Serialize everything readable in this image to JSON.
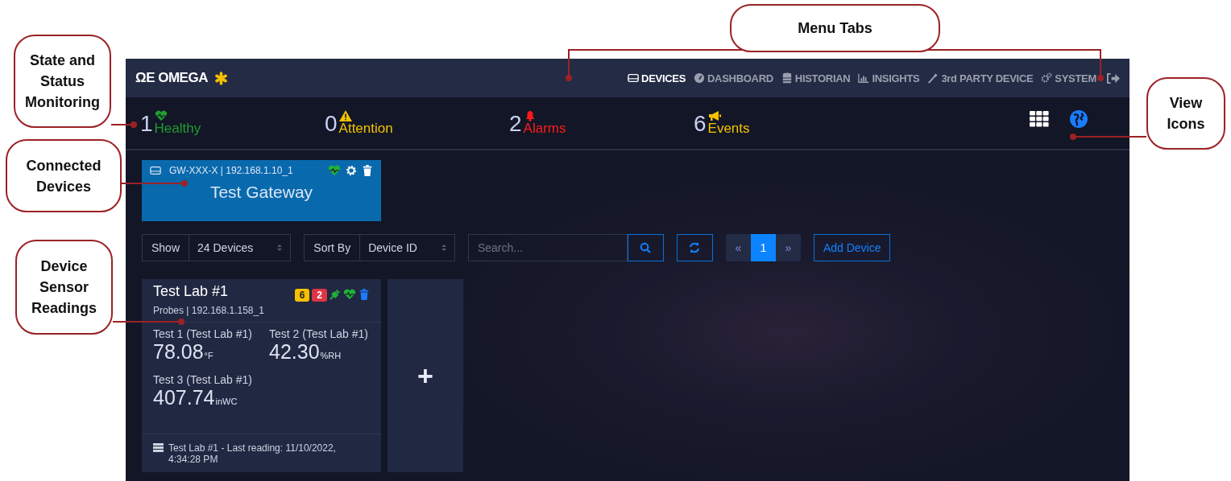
{
  "callouts": [
    {
      "kind": "tabs",
      "text": "Menu Tabs"
    },
    {
      "kind": "status",
      "text": "State and Status Monitoring"
    },
    {
      "kind": "devices",
      "text": "Connected Devices"
    },
    {
      "kind": "readings",
      "text": "Device Sensor Readings"
    },
    {
      "kind": "view",
      "text": "View Icons"
    }
  ],
  "header": {
    "logo": "OMEGA",
    "logo_mark": "ΩE",
    "tabs": [
      {
        "kind": "devices",
        "label": "DEVICES",
        "selected": true
      },
      {
        "kind": "dashboard",
        "label": "DASHBOARD",
        "selected": false
      },
      {
        "kind": "historian",
        "label": "HISTORIAN",
        "selected": false
      },
      {
        "kind": "insights",
        "label": "INSIGHTS",
        "selected": false
      },
      {
        "kind": "wand",
        "label": "3rd PARTY DEVICE",
        "selected": false
      },
      {
        "kind": "system",
        "label": "SYSTEM",
        "selected": false
      }
    ]
  },
  "status": [
    {
      "kind": "healthy",
      "count": "1",
      "label": "Healthy",
      "color": "#1e9e2e"
    },
    {
      "kind": "attention",
      "count": "0",
      "label": "Attention",
      "color": "#f2c200"
    },
    {
      "kind": "alarms",
      "count": "2",
      "label": "Alarms",
      "color": "#ff1a1a"
    },
    {
      "kind": "events",
      "count": "6",
      "label": "Events",
      "color": "#f2c200"
    }
  ],
  "gateway": {
    "id": "GW-XXX-X | 192.168.1.10_1",
    "name": "Test Gateway"
  },
  "controls": {
    "show_label": "Show",
    "show_value": "24 Devices",
    "sort_label": "Sort By",
    "sort_value": "Device ID",
    "search_placeholder": "Search...",
    "pages": [
      {
        "label": "«",
        "selected": false
      },
      {
        "label": "1",
        "selected": true
      },
      {
        "label": "»",
        "selected": false
      }
    ],
    "add_button": "Add Device"
  },
  "device": {
    "name": "Test Lab #1",
    "subtitle": "Probes | 192.168.1.158_1",
    "badges": [
      {
        "text": "6",
        "color": "#f5c000"
      },
      {
        "text": "2",
        "color": "#dc3545"
      }
    ],
    "readings": [
      {
        "name": "Test 1 (Test Lab #1)",
        "value": "78.08",
        "unit": "°F"
      },
      {
        "name": "Test 2 (Test Lab #1)",
        "value": "42.30",
        "unit": "%RH"
      },
      {
        "name": "Test 3 (Test Lab #1)",
        "value": "407.74",
        "unit": "inWC"
      }
    ],
    "footer": "Test Lab #1 - Last reading: 11/10/2022, 4:34:28 PM"
  },
  "add_card": {
    "symbol": "+"
  }
}
